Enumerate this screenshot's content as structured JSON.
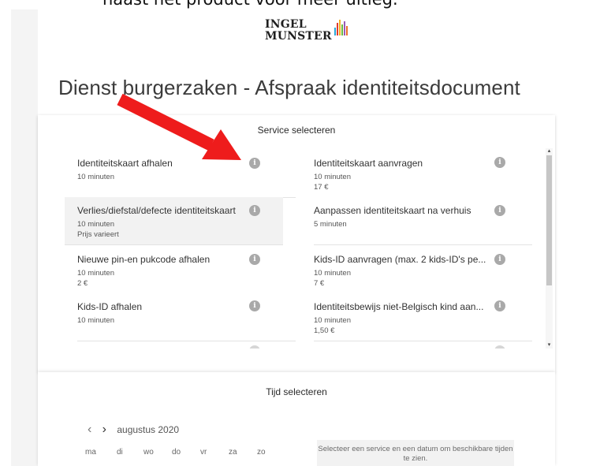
{
  "caption_top": "naast het product voor meer uitleg.",
  "logo": {
    "line1": "INGEL",
    "line2": "MUNSTER",
    "bar_colors": [
      "#2aa8d8",
      "#e23a2c",
      "#f3b325",
      "#6dbb3d",
      "#9b59b6",
      "#ec6f2b"
    ]
  },
  "page_title": "Dienst burgerzaken - Afspraak identiteitsdocument",
  "services_section": {
    "title": "Service selecteren",
    "info_glyph": "i",
    "items": [
      {
        "name": "Identiteitskaart afhalen",
        "duration": "10 minuten",
        "price": ""
      },
      {
        "name": "Identiteitskaart aanvragen",
        "duration": "10 minuten",
        "price": "17 €"
      },
      {
        "name": "Verlies/diefstal/defecte identiteitskaart",
        "duration": "10 minuten",
        "price": "Prijs varieert"
      },
      {
        "name": "Aanpassen identiteitskaart na verhuis",
        "duration": "5 minuten",
        "price": ""
      },
      {
        "name": "Nieuwe pin-en pukcode afhalen",
        "duration": "10 minuten",
        "price": "2 €"
      },
      {
        "name": "Kids-ID aanvragen (max. 2 kids-ID's pe...",
        "duration": "10 minuten",
        "price": "7 €"
      },
      {
        "name": "Kids-ID afhalen",
        "duration": "10 minuten",
        "price": ""
      },
      {
        "name": "Identiteitsbewijs niet-Belgisch kind aan...",
        "duration": "10 minuten",
        "price": "1,50 €"
      }
    ]
  },
  "time_section": {
    "title": "Tijd selecteren",
    "prev": "‹",
    "next": "›",
    "month": "augustus 2020",
    "weekdays": [
      "ma",
      "di",
      "wo",
      "do",
      "vr",
      "za",
      "zo"
    ],
    "hint": "Selecteer een service en een datum om beschikbare tijden te zien."
  },
  "colors": {
    "arrow": "#ee1c1c",
    "info_icon": "#a9a9a9",
    "selected_row": "#f2f2f2"
  }
}
